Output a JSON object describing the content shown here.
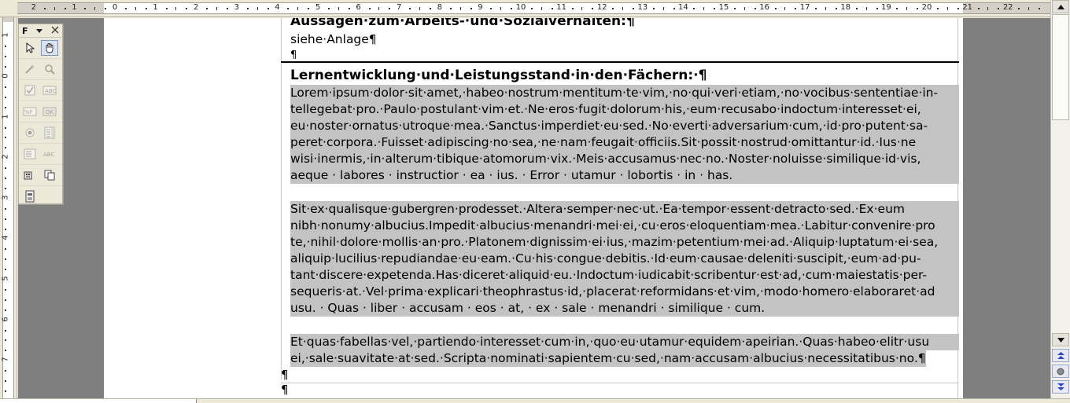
{
  "ruler": {
    "horizontal_labels": [
      "2",
      "1",
      "",
      "1",
      "2",
      "3",
      "4",
      "5",
      "6",
      "7",
      "8",
      "9",
      "10",
      "11",
      "12",
      "13",
      "14",
      "15",
      "16",
      "17",
      "18",
      "19",
      "20",
      "21",
      "22"
    ],
    "horizontal_zero": "0",
    "vertical_labels": [
      "1",
      "",
      "1",
      "2",
      "3",
      "4",
      "5",
      "6",
      "7"
    ],
    "vertical_zero": "0"
  },
  "toolbar": {
    "title": "F",
    "dropdown_icon": "chevron-down-icon",
    "close_icon": "close-icon"
  },
  "document": {
    "heading_prev": "Aussagen·zum·Arbeits-·und·Sozialverhalten:¶",
    "see_attachment": "siehe·Anlage¶",
    "empty_pilcrow": "¶",
    "heading": "Lernentwicklung·und·Leistungsstand·in·den·Fächern:·¶",
    "para1": [
      "Lorem·ipsum·dolor·sit·amet,·habeo·nostrum·mentitum·te·vim,·no·qui·veri·etiam,·no·vocibus·sententiae·in-",
      "tellegebat·pro.·Paulo·postulant·vim·et.·Ne·eros·fugit·dolorum·his,·eum·recusabo·indoctum·interesset·ei,",
      "eu·noster·ornatus·utroque·mea.·Sanctus·imperdiet·eu·sed.·No·everti·adversarium·cum,·id·pro·putent·sa-",
      "peret·corpora.·Fuisset·adipiscing·no·sea,·ne·nam·feugait·officiis.Sit·possit·nostrud·omittantur·id.·Ius·ne",
      "wisi·inermis,·in·alterum·tibique·atomorum·vix.·Meis·accusamus·nec·no.·Noster·noluisse·similique·id·vis,",
      "aeque · labores · instructior · ea · ius. · Error · utamur · lobortis · in · has."
    ],
    "para2": [
      "Sit·ex·qualisque·gubergren·prodesset.·Altera·semper·nec·ut.·Ea·tempor·essent·detracto·sed.·Ex·eum",
      "nibh·nonumy·albucius.Impedit·albucius·menandri·mei·ei,·cu·eros·eloquentiam·mea.·Labitur·convenire·pro",
      "te,·nihil·dolore·mollis·an·pro.·Platonem·dignissim·ei·ius,·mazim·petentium·mei·ad.·Aliquip·luptatum·ei·sea,",
      "aliquip·lucilius·repudiandae·eu·eam.·Cu·his·congue·debitis.·Id·eum·causae·deleniti·suscipit,·eum·ad·pu-",
      "tant·discere·expetenda.Has·diceret·aliquid·eu.·Indoctum·iudicabit·scribentur·est·ad,·cum·maiestatis·per-",
      "sequeris·at.·Vel·prima·explicari·theophrastus·id,·placerat·reformidans·et·vim,·modo·homero·elaboraret·ad",
      "usu. · Quas · liber · accusam · eos · at, · ex · sale · menandri · similique · cum."
    ],
    "para3": [
      "Et·quas·fabellas·vel,·partiendo·interesset·cum·in,·quo·eu·utamur·equidem·apeirian.·Quas·habeo·elitr·usu",
      "ei,·sale·suavitate·at·sed.·Scripta·nominati·sapientem·cu·sed,·nam·accusam·albucius·necessitatibus·no.¶"
    ],
    "trailing_pilcrows": [
      "¶",
      "¶"
    ]
  },
  "scrollbar": {
    "up_icon": "scroll-up-icon",
    "down_icon": "scroll-down-icon",
    "prev_page_icon": "previous-page-icon",
    "navigator_icon": "navigator-icon",
    "next_page_icon": "next-page-icon"
  }
}
